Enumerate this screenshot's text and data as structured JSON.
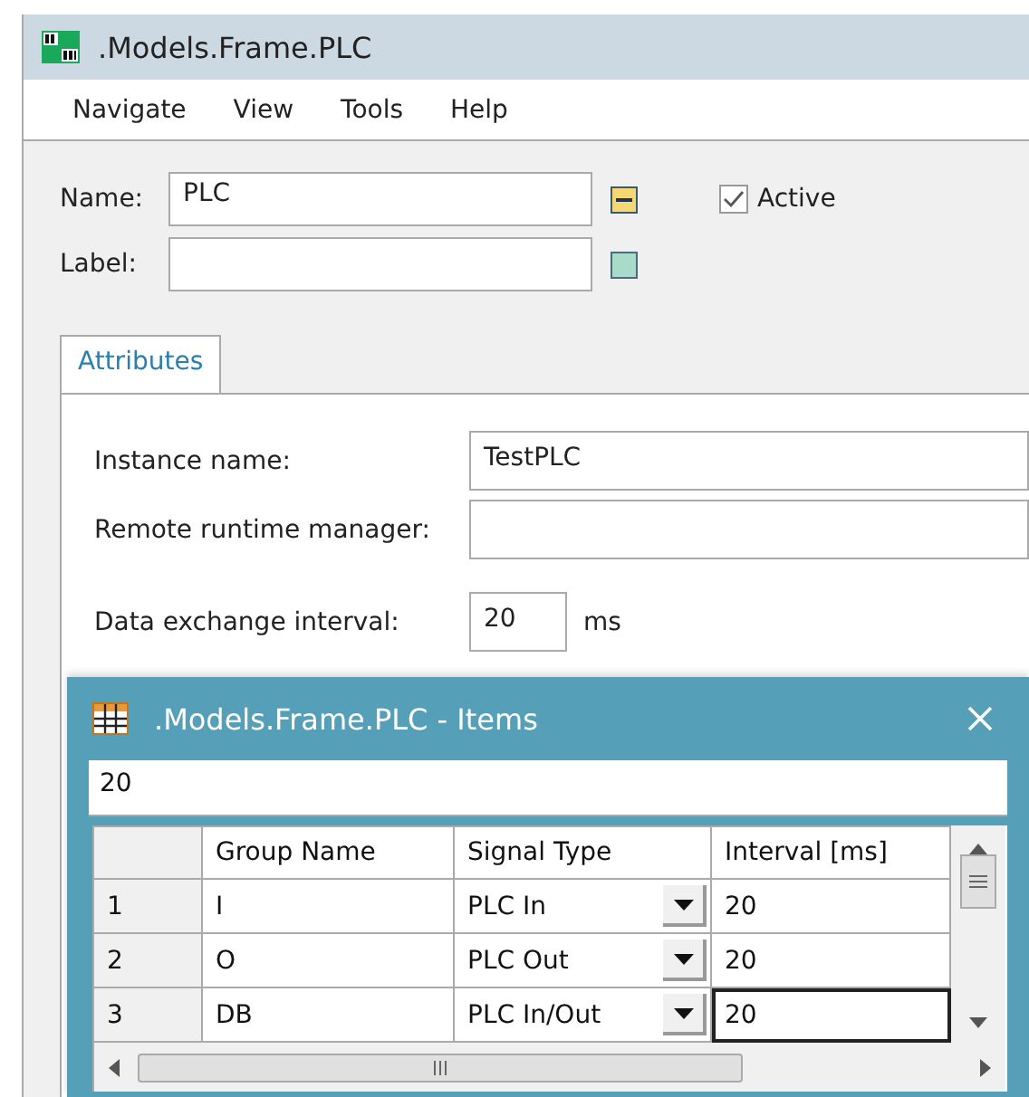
{
  "window": {
    "title": ".Models.Frame.PLC"
  },
  "menu": [
    "Navigate",
    "View",
    "Tools",
    "Help"
  ],
  "form": {
    "name_label": "Name:",
    "name_value": "PLC",
    "label_label": "Label:",
    "active": {
      "label": "Active",
      "checked": true
    }
  },
  "tabs": [
    {
      "label": "Attributes",
      "selected": true
    }
  ],
  "attributes": [
    {
      "label": "Instance name:",
      "value": "TestPLC",
      "kind": "wide"
    },
    {
      "label": "Remote runtime manager:",
      "kind": "wide"
    },
    {
      "label": "Data exchange interval:",
      "value": "20",
      "unit": "ms",
      "kind": "short"
    }
  ],
  "dialog": {
    "title": ".Models.Frame.PLC - Items",
    "edit_value": "20",
    "columns": [
      "Group Name",
      "Signal Type",
      "Interval [ms]"
    ],
    "rows": [
      {
        "index": "1",
        "group": "I",
        "signal": "PLC In",
        "interval": "20",
        "focused": false
      },
      {
        "index": "2",
        "group": "O",
        "signal": "PLC Out",
        "interval": "20",
        "focused": false
      },
      {
        "index": "3",
        "group": "DB",
        "signal": "PLC In/Out",
        "interval": "20",
        "focused": true
      }
    ]
  }
}
